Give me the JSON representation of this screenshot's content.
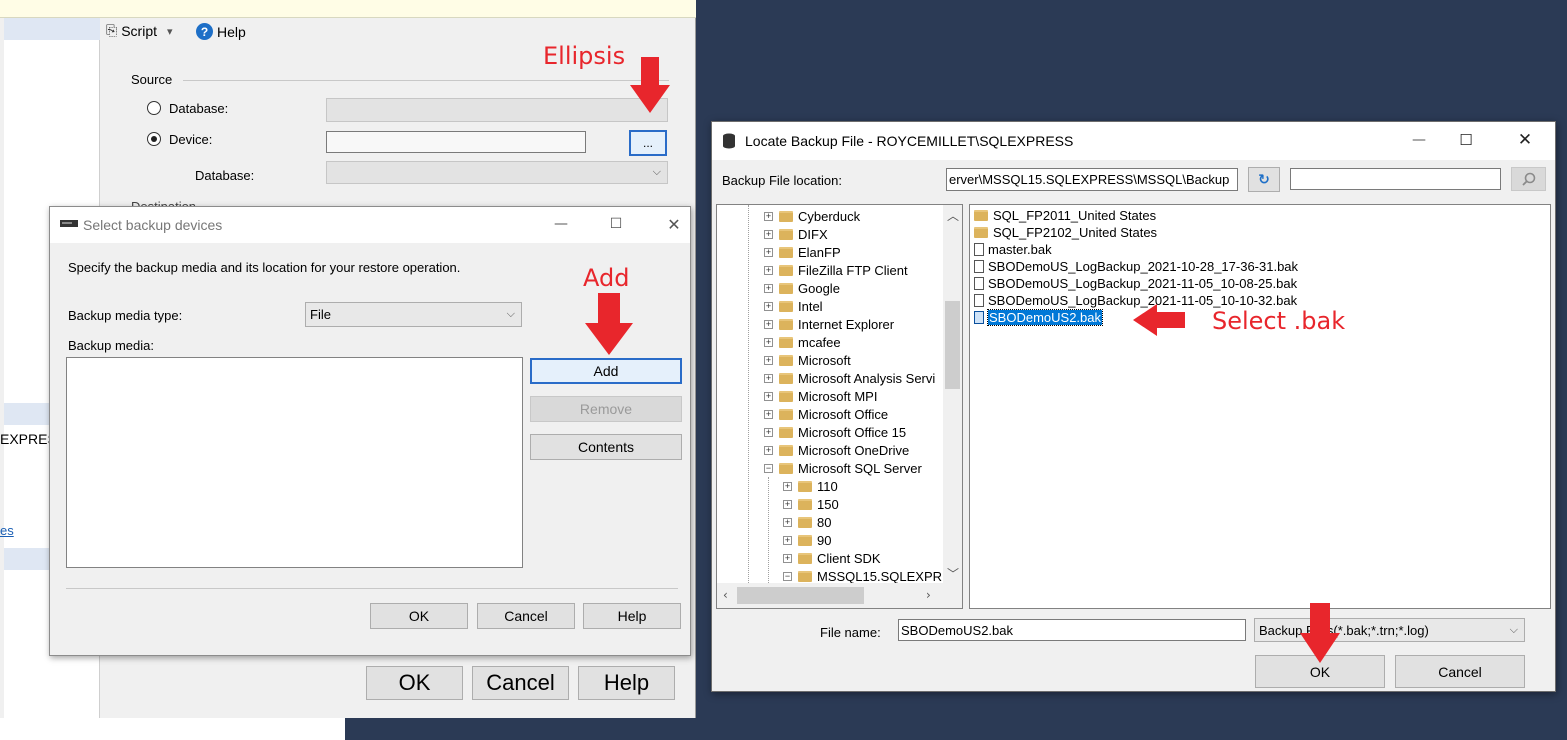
{
  "restore_dialog": {
    "toolbar": {
      "script_label": "Script",
      "help_label": "Help"
    },
    "source_label": "Source",
    "database_radio_label": "Database:",
    "device_radio_label": "Device:",
    "ellipsis_label": "...",
    "database_label": "Database:",
    "destination_label": "Destination",
    "left_text_express": "EXPRESS",
    "left_link_text": "es",
    "ok_label": "OK",
    "cancel_label": "Cancel",
    "help_label": "Help"
  },
  "select_backup_devices": {
    "title": "Select backup devices",
    "instruction": "Specify the backup media and its location for your restore operation.",
    "media_type_label": "Backup media type:",
    "media_type_value": "File",
    "backup_media_label": "Backup media:",
    "add_label": "Add",
    "remove_label": "Remove",
    "contents_label": "Contents",
    "ok_label": "OK",
    "cancel_label": "Cancel",
    "help_label": "Help"
  },
  "locate_backup_file": {
    "title": "Locate Backup File - ROYCEMILLET\\SQLEXPRESS",
    "location_label": "Backup File location:",
    "location_value": "erver\\MSSQL15.SQLEXPRESS\\MSSQL\\Backup",
    "search_value": "",
    "tree_items": [
      {
        "label": "Cyberduck",
        "level": 0,
        "expander": "+"
      },
      {
        "label": "DIFX",
        "level": 0,
        "expander": "+"
      },
      {
        "label": "ElanFP",
        "level": 0,
        "expander": "+"
      },
      {
        "label": "FileZilla FTP Client",
        "level": 0,
        "expander": "+"
      },
      {
        "label": "Google",
        "level": 0,
        "expander": "+"
      },
      {
        "label": "Intel",
        "level": 0,
        "expander": "+"
      },
      {
        "label": "Internet Explorer",
        "level": 0,
        "expander": "+"
      },
      {
        "label": "mcafee",
        "level": 0,
        "expander": "+"
      },
      {
        "label": "Microsoft",
        "level": 0,
        "expander": "+"
      },
      {
        "label": "Microsoft Analysis Servi",
        "level": 0,
        "expander": "+"
      },
      {
        "label": "Microsoft MPI",
        "level": 0,
        "expander": "+"
      },
      {
        "label": "Microsoft Office",
        "level": 0,
        "expander": "+"
      },
      {
        "label": "Microsoft Office 15",
        "level": 0,
        "expander": "+"
      },
      {
        "label": "Microsoft OneDrive",
        "level": 0,
        "expander": "+"
      },
      {
        "label": "Microsoft SQL Server",
        "level": 0,
        "expander": "−"
      },
      {
        "label": "110",
        "level": 1,
        "expander": "+"
      },
      {
        "label": "150",
        "level": 1,
        "expander": "+"
      },
      {
        "label": "80",
        "level": 1,
        "expander": "+"
      },
      {
        "label": "90",
        "level": 1,
        "expander": "+"
      },
      {
        "label": "Client SDK",
        "level": 1,
        "expander": "+"
      },
      {
        "label": "MSSQL15.SQLEXPR",
        "level": 1,
        "expander": "−"
      }
    ],
    "files": [
      {
        "name": "SQL_FP2011_United States",
        "kind": "folder",
        "selected": false
      },
      {
        "name": "SQL_FP2102_United States",
        "kind": "folder",
        "selected": false
      },
      {
        "name": "master.bak",
        "kind": "file",
        "selected": false
      },
      {
        "name": "SBODemoUS_LogBackup_2021-10-28_17-36-31.bak",
        "kind": "file",
        "selected": false
      },
      {
        "name": "SBODemoUS_LogBackup_2021-11-05_10-08-25.bak",
        "kind": "file",
        "selected": false
      },
      {
        "name": "SBODemoUS_LogBackup_2021-11-05_10-10-32.bak",
        "kind": "file",
        "selected": false
      },
      {
        "name": "SBODemoUS2.bak",
        "kind": "file",
        "selected": true
      }
    ],
    "file_name_label": "File name:",
    "file_name_value": "SBODemoUS2.bak",
    "filter_value": "Backup Files(*.bak;*.trn;*.log)",
    "ok_label": "OK",
    "cancel_label": "Cancel"
  },
  "annotations": {
    "ellipsis": "Ellipsis",
    "add": "Add",
    "select_bak": "Select .bak",
    "arrow_color": "#e8262c"
  }
}
